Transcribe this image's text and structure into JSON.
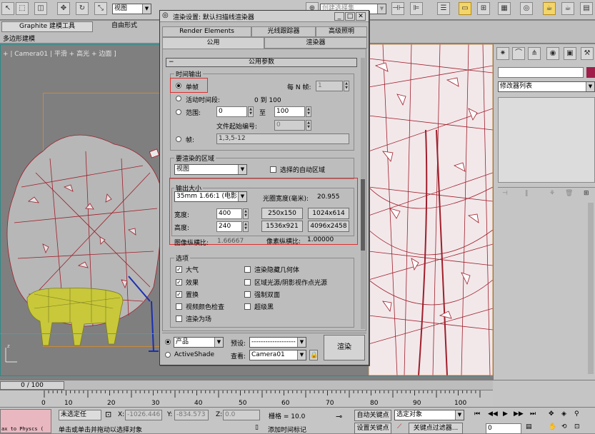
{
  "toolbar": {
    "view_select": "视图",
    "selection_set": "创建选择集"
  },
  "ribbon": {
    "tab_graphite": "Graphite 建模工具",
    "tab_freeform": "自由形式",
    "subtitle": "多边形建模"
  },
  "viewport": {
    "label": "+ | Camera01 | 平滑 + 高光 + 边面 ]"
  },
  "command_panel": {
    "modifier_list": "修改器列表"
  },
  "dialog": {
    "title": "渲染设置: 默认扫描线渲染器",
    "tabs_row1": [
      "Render Elements",
      "光线跟踪器",
      "高级照明"
    ],
    "tabs_row2": [
      "公用",
      "渲染器"
    ],
    "rollout_title": "公用参数",
    "time_output": {
      "group_label": "时间输出",
      "single": "单帧",
      "every_n_label": "每 N 帧:",
      "every_n_value": "1",
      "active_segment": "活动时间段:",
      "active_segment_value": "0 到 100",
      "range": "范围:",
      "range_from": "0",
      "range_to_label": "至",
      "range_to": "100",
      "file_start_label": "文件起始编号:",
      "file_start_value": "0",
      "frames_label": "帧:",
      "frames_value": "1,3,5-12"
    },
    "render_area": {
      "group_label": "要渲染的区域",
      "combo": "视图",
      "auto_region": "选择的自动区域"
    },
    "output_size": {
      "group_label": "输出大小",
      "preset": "35mm 1.66:1 (电影)",
      "aperture_label": "光圈宽度(毫米):",
      "aperture_value": "20.955",
      "width_label": "宽度:",
      "width_value": "400",
      "height_label": "高度:",
      "height_value": "240",
      "presets": [
        "250x150",
        "1024x614",
        "1536x921",
        "4096x2458"
      ],
      "image_aspect_label": "图像纵横比:",
      "image_aspect_value": "1.66667",
      "pixel_aspect_label": "像素纵横比:",
      "pixel_aspect_value": "1.00000"
    },
    "options": {
      "group_label": "选项",
      "left": [
        {
          "label": "大气",
          "checked": true
        },
        {
          "label": "效果",
          "checked": true
        },
        {
          "label": "置换",
          "checked": true
        },
        {
          "label": "视频颜色检查",
          "checked": false
        },
        {
          "label": "渲染为场",
          "checked": false
        }
      ],
      "right": [
        {
          "label": "渲染隐藏几何体",
          "checked": false
        },
        {
          "label": "区域光源/阴影视作点光源",
          "checked": false
        },
        {
          "label": "强制双面",
          "checked": false
        },
        {
          "label": "超级黑",
          "checked": false
        }
      ]
    },
    "bottom": {
      "mode_product": "产品",
      "mode_activeshade": "ActiveShade",
      "preset_label": "预设:",
      "preset_value": "-------------------",
      "view_label": "查看:",
      "view_value": "Camera01",
      "render_button": "渲染"
    }
  },
  "timeline": {
    "frame_counter": "0 / 100",
    "ticks": [
      "0",
      "10",
      "20",
      "30",
      "40",
      "50",
      "60",
      "70",
      "80",
      "90",
      "100"
    ]
  },
  "status": {
    "script": "ax to Physcs (",
    "selection": "未选定任",
    "x_label": "X:",
    "x_value": "-1026.446",
    "y_label": "Y:",
    "y_value": "-834.573",
    "z_label": "Z:",
    "z_value": "0.0",
    "grid": "栅格 = 10.0",
    "prompt": "单击或单击并拖动以选择对象",
    "add_time_tag": "添加时间标记",
    "auto_key": "自动关键点",
    "set_key": "设置关键点",
    "selected_object": "选定对象",
    "key_filter": "关键点过滤器..."
  },
  "colors": {
    "accent_yellow": "#f3d56a",
    "highlight_red": "#e03030",
    "wire_red": "#a01e2a",
    "cow_yellow": "#c8c83a"
  }
}
